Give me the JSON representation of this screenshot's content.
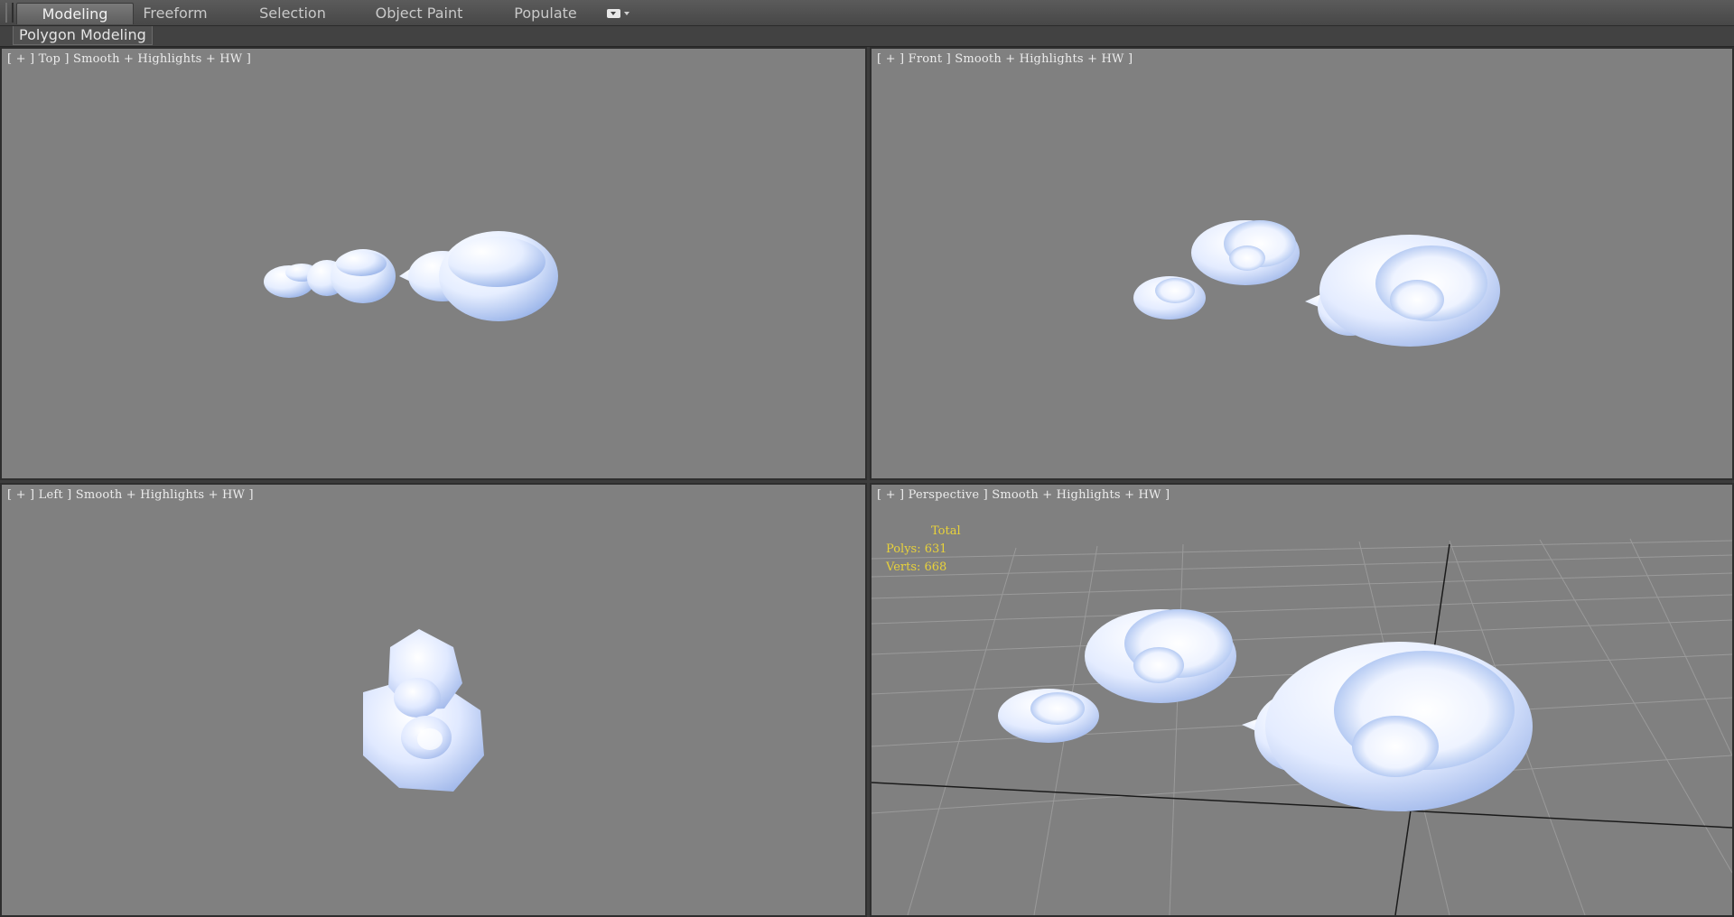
{
  "ribbon": {
    "tabs": [
      {
        "label": "Modeling",
        "active": true
      },
      {
        "label": "Freeform",
        "active": false
      },
      {
        "label": "Selection",
        "active": false
      },
      {
        "label": "Object Paint",
        "active": false
      },
      {
        "label": "Populate",
        "active": false
      }
    ],
    "options_icon": "ribbon-options-icon",
    "panel_label": "Polygon Modeling"
  },
  "viewports": {
    "top": {
      "label": "[ + ] Top ] Smooth + Highlights + HW ]"
    },
    "front": {
      "label": "[ + ] Front ] Smooth + Highlights + HW ]"
    },
    "left": {
      "label": "[ + ] Left ] Smooth + Highlights + HW ]"
    },
    "perspective": {
      "label": "[ + ] Perspective ] Smooth + Highlights + HW ]",
      "stats": {
        "total": "Total",
        "polys": "Polys: 631",
        "verts": "Verts: 668"
      }
    }
  },
  "colors": {
    "viewport_bg": "#808080",
    "stats_text": "#e8d23a",
    "cloud_light": "#ffffff",
    "cloud_shade": "#9fb8ec"
  }
}
